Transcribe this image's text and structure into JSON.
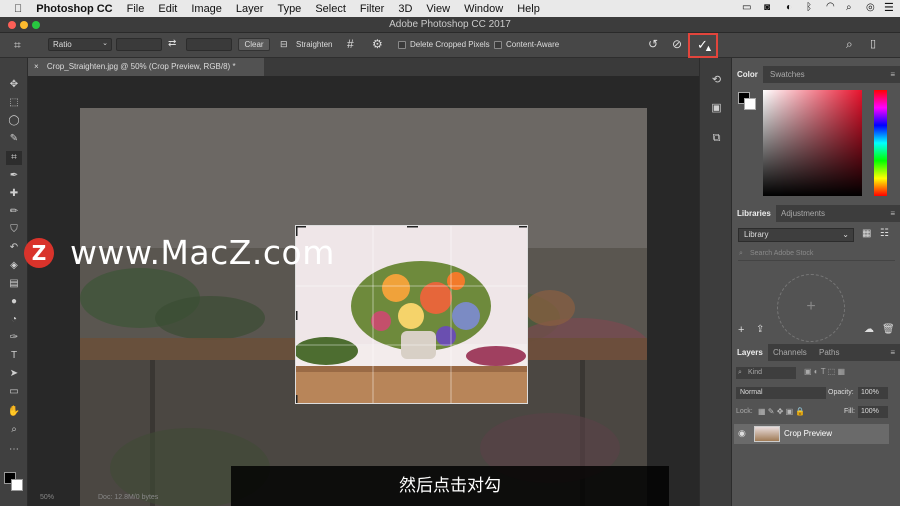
{
  "menubar": {
    "app_name": "Photoshop CC",
    "items": [
      "File",
      "Edit",
      "Image",
      "Layer",
      "Type",
      "Select",
      "Filter",
      "3D",
      "View",
      "Window",
      "Help"
    ]
  },
  "window": {
    "title": "Adobe Photoshop CC 2017"
  },
  "options": {
    "ratio_label": "Ratio",
    "clear_label": "Clear",
    "straighten_label": "Straighten",
    "delete_cropped_label": "Delete Cropped Pixels",
    "content_aware_label": "Content-Aware"
  },
  "document": {
    "tab_title": "Crop_Straighten.jpg @ 50% (Crop Preview, RGB/8) *"
  },
  "status": {
    "zoom": "50%",
    "doc_info": "Doc: 12.8M/0 bytes"
  },
  "color_panel": {
    "tabs": [
      "Color",
      "Swatches"
    ]
  },
  "libraries_panel": {
    "tabs": [
      "Libraries",
      "Adjustments"
    ],
    "library_select": "Library",
    "search_placeholder": "Search Adobe Stock"
  },
  "layers_panel": {
    "tabs": [
      "Layers",
      "Channels",
      "Paths"
    ],
    "kind_label": "Kind",
    "blend_mode": "Normal",
    "opacity_label": "Opacity:",
    "opacity_value": "100%",
    "lock_label": "Lock:",
    "fill_label": "Fill:",
    "fill_value": "100%",
    "layer_name": "Crop Preview"
  },
  "overlay": {
    "subtitle": "然后点击对勾",
    "watermark_logo": "Z",
    "watermark_text": "www.MacZ.com"
  },
  "colors": {
    "commit_highlight": "#e2453c",
    "watermark_red": "#d9332b"
  }
}
